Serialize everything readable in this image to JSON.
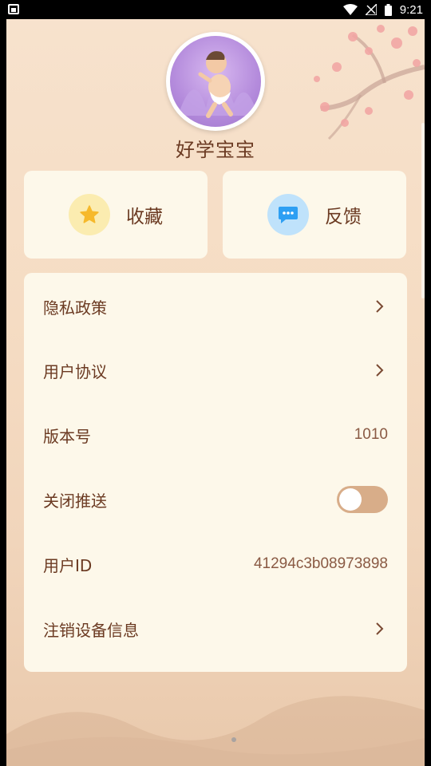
{
  "status_bar": {
    "time": "9:21"
  },
  "profile": {
    "nickname": "好学宝宝"
  },
  "actions": [
    {
      "label": "收藏",
      "icon": "star-icon",
      "color": "#f6b92b",
      "bg": "#fbecb0"
    },
    {
      "label": "反馈",
      "icon": "chat-icon",
      "color": "#2d9ff3",
      "bg": "#bfe2fb"
    }
  ],
  "settings": {
    "privacy": {
      "label": "隐私政策"
    },
    "agreement": {
      "label": "用户协议"
    },
    "version": {
      "label": "版本号",
      "value": "1010"
    },
    "push": {
      "label": "关闭推送",
      "enabled": false
    },
    "user_id": {
      "label": "用户ID",
      "value": "41294c3b08973898"
    },
    "deregister": {
      "label": "注销设备信息"
    }
  },
  "colors": {
    "accent_text": "#6b3a22",
    "card_bg": "#fdf8ea",
    "toggle_track": "#d8ad89"
  }
}
